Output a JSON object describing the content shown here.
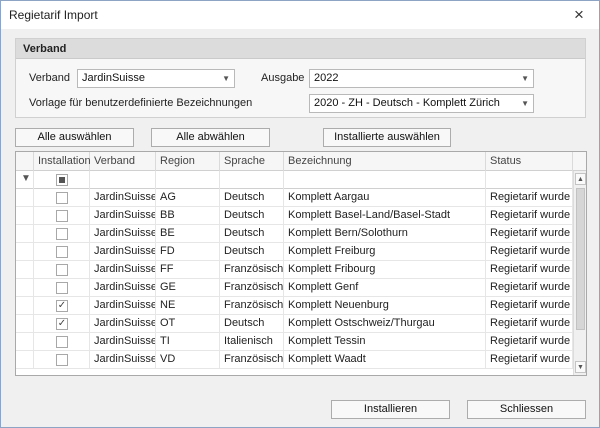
{
  "window": {
    "title": "Regietarif Import",
    "close_icon": "×"
  },
  "group": {
    "title": "Verband",
    "verband_label": "Verband",
    "verband_value": "JardinSuisse",
    "ausgabe_label": "Ausgabe",
    "ausgabe_value": "2022",
    "vorlage_label": "Vorlage für benutzerdefinierte Bezeichnungen",
    "vorlage_value": "2020 - ZH - Deutsch - Komplett Zürich"
  },
  "buttons": {
    "select_all": "Alle auswählen",
    "deselect_all": "Alle abwählen",
    "select_installed": "Installierte auswählen",
    "install": "Installieren",
    "close": "Schliessen"
  },
  "grid": {
    "columns": [
      "Installation",
      "Verband",
      "Region",
      "Sprache",
      "Bezeichnung",
      "Status"
    ],
    "rows": [
      {
        "checked": false,
        "verband": "JardinSuisse",
        "region": "AG",
        "sprache": "Deutsch",
        "bezeichnung": "Komplett Aargau",
        "status": "Regietarif wurde ..."
      },
      {
        "checked": false,
        "verband": "JardinSuisse",
        "region": "BB",
        "sprache": "Deutsch",
        "bezeichnung": "Komplett Basel-Land/Basel-Stadt",
        "status": "Regietarif wurde ..."
      },
      {
        "checked": false,
        "verband": "JardinSuisse",
        "region": "BE",
        "sprache": "Deutsch",
        "bezeichnung": "Komplett Bern/Solothurn",
        "status": "Regietarif wurde ..."
      },
      {
        "checked": false,
        "verband": "JardinSuisse",
        "region": "FD",
        "sprache": "Deutsch",
        "bezeichnung": "Komplett Freiburg",
        "status": "Regietarif wurde ..."
      },
      {
        "checked": false,
        "verband": "JardinSuisse",
        "region": "FF",
        "sprache": "Französisch",
        "bezeichnung": "Komplett Fribourg",
        "status": "Regietarif wurde ..."
      },
      {
        "checked": false,
        "verband": "JardinSuisse",
        "region": "GE",
        "sprache": "Französisch",
        "bezeichnung": "Komplett Genf",
        "status": "Regietarif wurde ..."
      },
      {
        "checked": true,
        "verband": "JardinSuisse",
        "region": "NE",
        "sprache": "Französisch",
        "bezeichnung": "Komplett Neuenburg",
        "status": "Regietarif wurde ..."
      },
      {
        "checked": true,
        "verband": "JardinSuisse",
        "region": "OT",
        "sprache": "Deutsch",
        "bezeichnung": "Komplett Ostschweiz/Thurgau",
        "status": "Regietarif wurde ..."
      },
      {
        "checked": false,
        "verband": "JardinSuisse",
        "region": "TI",
        "sprache": "Italienisch",
        "bezeichnung": "Komplett Tessin",
        "status": "Regietarif wurde ..."
      },
      {
        "checked": false,
        "verband": "JardinSuisse",
        "region": "VD",
        "sprache": "Französisch",
        "bezeichnung": "Komplett Waadt",
        "status": "Regietarif wurde ..."
      }
    ]
  },
  "icons": {
    "filter": "funnel-icon",
    "dropdown": "chevron-down-icon",
    "scroll_up": "triangle-up-icon",
    "scroll_down": "triangle-down-icon"
  }
}
